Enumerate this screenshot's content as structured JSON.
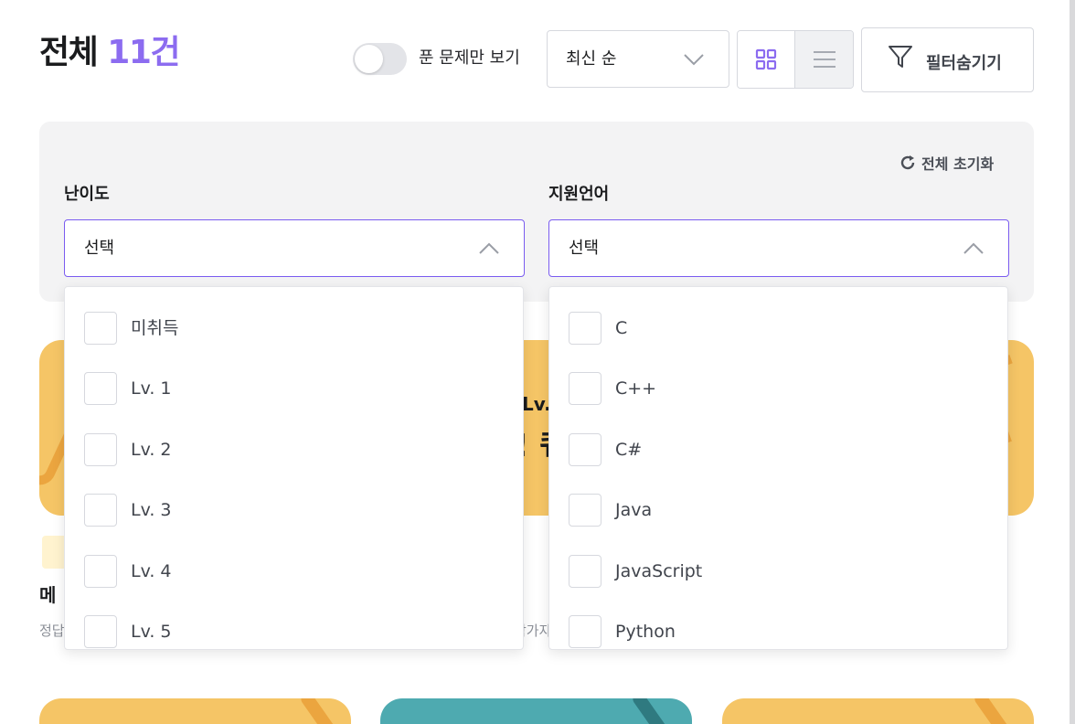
{
  "header": {
    "title_prefix": "전체",
    "title_count": "11건",
    "toggle_label": "푼 문제만 보기",
    "sort_value": "최신 순",
    "filter_button_label": "필터숨기기"
  },
  "filters": {
    "reset_label": "전체 초기화",
    "difficulty": {
      "label": "난이도",
      "value": "선택",
      "options": [
        "미취득",
        "Lv. 1",
        "Lv. 2",
        "Lv. 3",
        "Lv. 4",
        "Lv. 5"
      ]
    },
    "language": {
      "label": "지원언어",
      "value": "선택",
      "options": [
        "C",
        "C++",
        "C#",
        "Java",
        "JavaScript",
        "Python"
      ]
    }
  },
  "card": {
    "banner_text_1": "Lv.",
    "banner_text_2": "! 퀘",
    "title": "메",
    "meta_left": "정답",
    "meta_right": "참가자"
  },
  "colors": {
    "accent": "#8c6cf0",
    "select_border": "#7a5cf0",
    "card_yellow": "#f5c566",
    "card_teal": "#4eaab0"
  },
  "icons": {
    "sort_chevron": "chevron-down-icon",
    "grid_view": "grid-icon",
    "list_view": "list-icon",
    "filter": "filter-icon",
    "reset": "refresh-icon"
  }
}
